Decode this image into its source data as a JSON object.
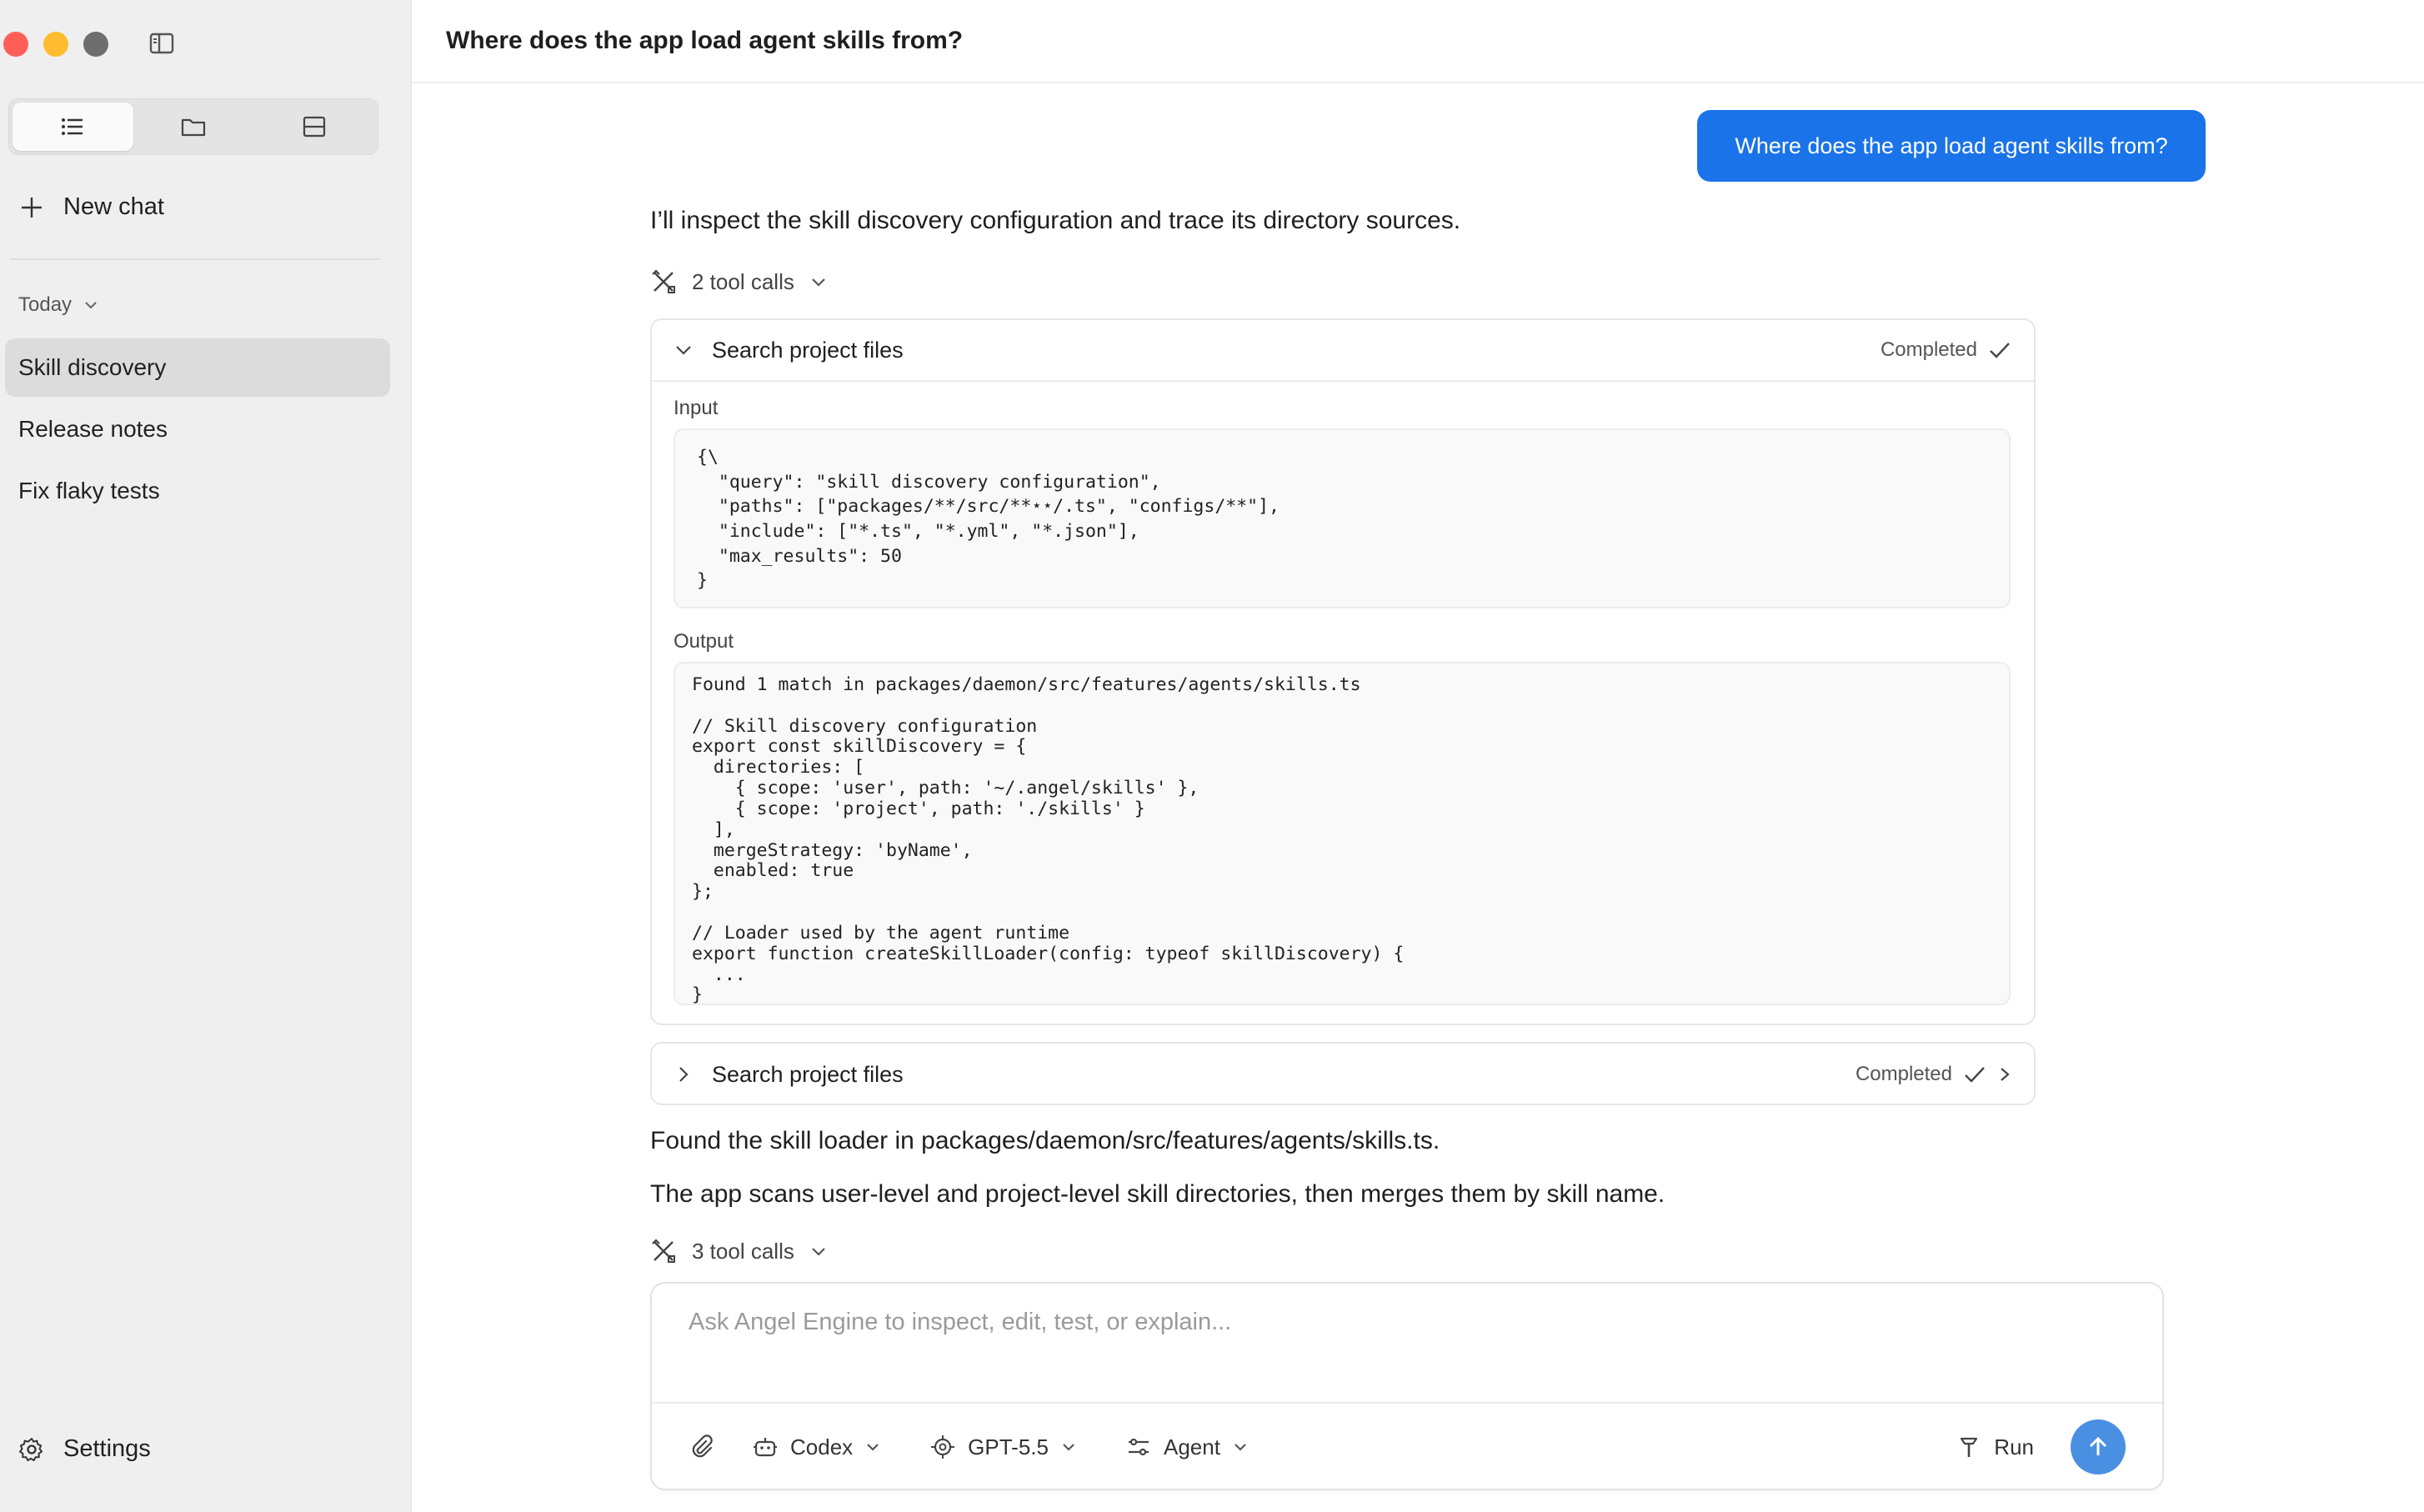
{
  "sidebar": {
    "new_chat_label": "New chat",
    "section_label": "Today",
    "chats": [
      {
        "label": "Skill discovery"
      },
      {
        "label": "Release notes"
      },
      {
        "label": "Fix flaky tests"
      }
    ],
    "settings_label": "Settings"
  },
  "header": {
    "title": "Where does the app load agent skills from?"
  },
  "conversation": {
    "user_message": "Where does the app load agent skills from?",
    "assistant_intro": "I’ll inspect the skill discovery configuration and trace its directory sources.",
    "tool_calls_1": "2 tool calls",
    "card1": {
      "title": "Search project files",
      "status": "Completed",
      "input_label": "Input",
      "input_code": "{\\\n  \"query\": \"skill discovery configuration\",\n  \"paths\": [\"packages/**/src/**⋆⋆/.ts\", \"configs/**\"],\n  \"include\": [\"*.ts\", \"*.yml\", \"*.json\"],\n  \"max_results\": 50\n}",
      "output_label": "Output",
      "output_code": "Found 1 match in packages/daemon/src/features/agents/skills.ts\n\n// Skill discovery configuration\nexport const skillDiscovery = {\n  directories: [\n    { scope: 'user', path: '~/.angel/skills' },\n    { scope: 'project', path: './skills' }\n  ],\n  mergeStrategy: 'byName',\n  enabled: true\n};\n\n// Loader used by the agent runtime\nexport function createSkillLoader(config: typeof skillDiscovery) {\n  ...\n}"
    },
    "card2": {
      "title": "Search project files",
      "status": "Completed"
    },
    "found_text": "Found the skill loader in packages/daemon/src/features/agents/skills.ts.",
    "summary_text": "The app scans user-level and project-level skill directories, then merges them by skill name.",
    "tool_calls_2": "3 tool calls"
  },
  "composer": {
    "placeholder": "Ask Angel Engine to inspect, edit, test, or explain...",
    "agent_provider": "Codex",
    "model": "GPT-5.5",
    "mode": "Agent",
    "run_label": "Run"
  },
  "colors": {
    "accent": "#1a73e8",
    "send_button": "#4a90e2",
    "sidebar_bg": "#efefef"
  }
}
